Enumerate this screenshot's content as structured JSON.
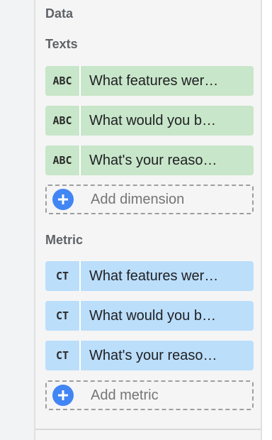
{
  "panel": {
    "section_title": "Data",
    "dimensions": {
      "title": "Texts",
      "items": [
        {
          "type": "ABC",
          "label": "What features wer…"
        },
        {
          "type": "ABC",
          "label": "What would you b…"
        },
        {
          "type": "ABC",
          "label": "What's your reaso…"
        }
      ],
      "add_label": "Add dimension"
    },
    "metrics": {
      "title": "Metric",
      "items": [
        {
          "type": "CT",
          "label": "What features wer…"
        },
        {
          "type": "CT",
          "label": "What would you b…"
        },
        {
          "type": "CT",
          "label": "What's your reaso…"
        }
      ],
      "add_label": "Add metric"
    }
  },
  "colors": {
    "dimension_chip": "#c8e6c9",
    "metric_chip": "#bbdefb",
    "add_icon": "#4285f4"
  }
}
